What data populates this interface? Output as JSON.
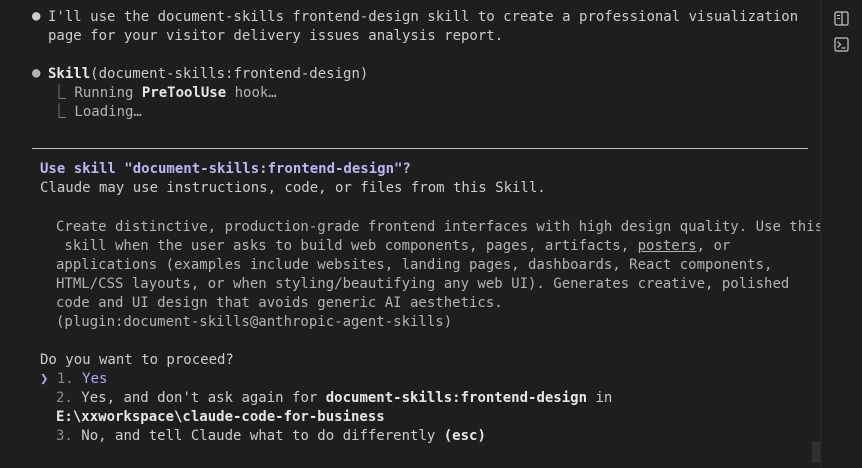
{
  "intro": {
    "bullet": "●",
    "line1": "I'll use the document-skills frontend-design skill to create a professional visualization",
    "line2": "page for your visitor delivery issues analysis report."
  },
  "tool_call": {
    "bullet": "●",
    "name": "Skill",
    "args": "(document-skills:frontend-design)",
    "sub1_prefix": "⎿ Running ",
    "sub1_bold": "PreToolUse",
    "sub1_suffix": " hook…",
    "sub2": "⎿ Loading…"
  },
  "prompt": {
    "title": "Use skill \"document-skills:frontend-design\"?",
    "subtitle": "Claude may use instructions, code, or files from this Skill.",
    "desc_line1": "Create distinctive, production-grade frontend interfaces with high design quality. Use this",
    "desc_line2_pre": " skill when the user asks to build web components, pages, artifacts, ",
    "desc_line2_link": "posters",
    "desc_line2_post": ", or",
    "desc_line3": "applications (examples include websites, landing pages, dashboards, React components,",
    "desc_line4": "HTML/CSS layouts, or when styling/beautifying any web UI). Generates creative, polished",
    "desc_line5": "code and UI design that avoids generic AI aesthetics.",
    "desc_line6": "(plugin:document-skills@anthropic-agent-skills)",
    "question": "Do you want to proceed?",
    "cursor": "❯",
    "option1_num": "1.",
    "option1_label": "Yes",
    "option2_num": "2.",
    "option2_pre": "Yes, and don't ask again for ",
    "option2_bold": "document-skills:frontend-design",
    "option2_post": " in",
    "option2_path": "E:\\xxworkspace\\claude-code-for-business",
    "option3_num": "3.",
    "option3_label": "No, and tell Claude what to do differently ",
    "option3_hint": "(esc)"
  },
  "sidebar": {
    "icons": [
      "split-panel-icon",
      "terminal-icon"
    ]
  }
}
